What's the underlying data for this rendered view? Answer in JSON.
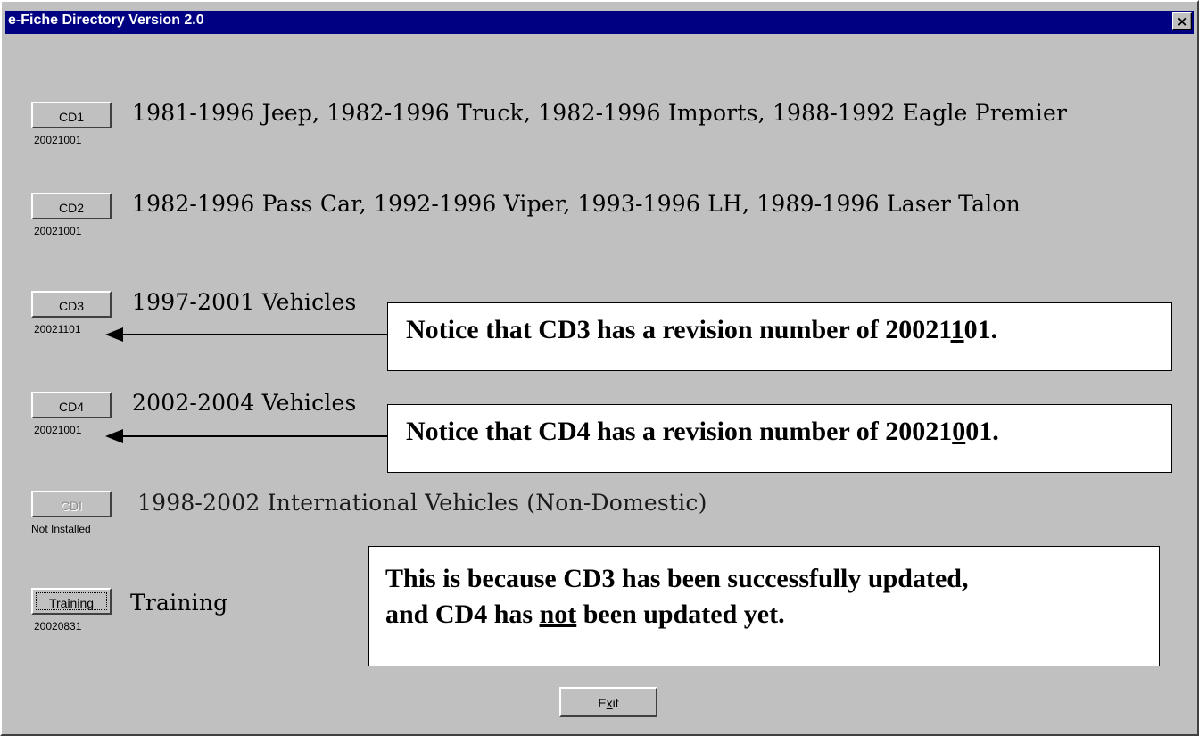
{
  "window": {
    "title": "e-Fiche Directory Version 2.0",
    "close_label": "×"
  },
  "cds": [
    {
      "label": "CD1",
      "revision": "20021001",
      "description": "1981-1996 Jeep, 1982-1996 Truck, 1982-1996 Imports, 1988-1992 Eagle Premier",
      "enabled": true
    },
    {
      "label": "CD2",
      "revision": "20021001",
      "description": "1982-1996 Pass Car, 1992-1996 Viper, 1993-1996 LH, 1989-1996 Laser Talon",
      "enabled": true
    },
    {
      "label": "CD3",
      "revision": "20021101",
      "description": "1997-2001 Vehicles",
      "enabled": true
    },
    {
      "label": "CD4",
      "revision": "20021001",
      "description": "2002-2004 Vehicles",
      "enabled": true
    },
    {
      "label": "CDI",
      "revision": "Not Installed",
      "description": "1998-2002 International Vehicles (Non-Domestic)",
      "enabled": false
    },
    {
      "label": "Training",
      "revision": "20020831",
      "description": "Training",
      "enabled": true
    }
  ],
  "callouts": {
    "cd3": {
      "prefix": "Notice that CD3 has a revision number of 20021",
      "underlined": "1",
      "suffix": "01."
    },
    "cd4": {
      "prefix": "Notice that CD4 has a revision number of 20021",
      "underlined": "0",
      "suffix": "01."
    },
    "explanation": {
      "line1": "This is because CD3 has been successfully updated,",
      "line2_prefix": "and CD4 has ",
      "line2_underlined": "not",
      "line2_suffix": " been updated yet."
    }
  },
  "exit": {
    "label_prefix": "E",
    "label_underlined": "x",
    "label_suffix": "it"
  }
}
